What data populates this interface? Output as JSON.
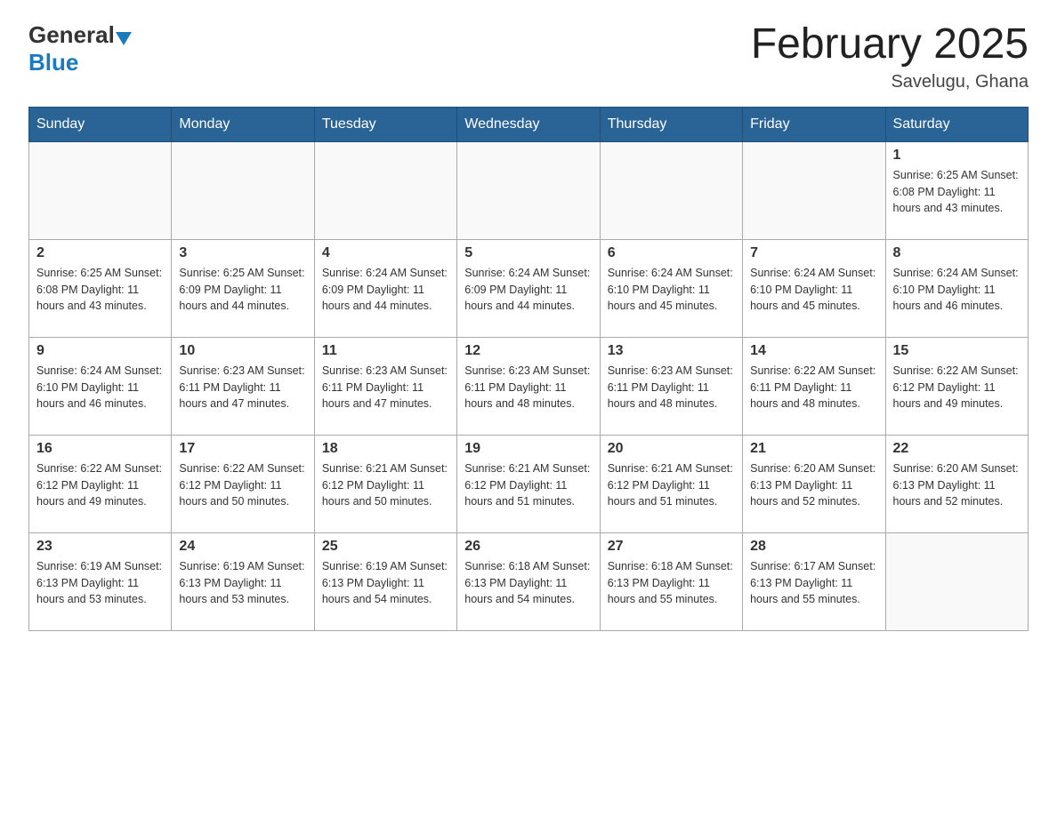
{
  "header": {
    "logo_general": "General",
    "logo_blue": "Blue",
    "title": "February 2025",
    "location": "Savelugu, Ghana"
  },
  "weekdays": [
    "Sunday",
    "Monday",
    "Tuesday",
    "Wednesday",
    "Thursday",
    "Friday",
    "Saturday"
  ],
  "weeks": [
    [
      {
        "day": "",
        "info": ""
      },
      {
        "day": "",
        "info": ""
      },
      {
        "day": "",
        "info": ""
      },
      {
        "day": "",
        "info": ""
      },
      {
        "day": "",
        "info": ""
      },
      {
        "day": "",
        "info": ""
      },
      {
        "day": "1",
        "info": "Sunrise: 6:25 AM\nSunset: 6:08 PM\nDaylight: 11 hours\nand 43 minutes."
      }
    ],
    [
      {
        "day": "2",
        "info": "Sunrise: 6:25 AM\nSunset: 6:08 PM\nDaylight: 11 hours\nand 43 minutes."
      },
      {
        "day": "3",
        "info": "Sunrise: 6:25 AM\nSunset: 6:09 PM\nDaylight: 11 hours\nand 44 minutes."
      },
      {
        "day": "4",
        "info": "Sunrise: 6:24 AM\nSunset: 6:09 PM\nDaylight: 11 hours\nand 44 minutes."
      },
      {
        "day": "5",
        "info": "Sunrise: 6:24 AM\nSunset: 6:09 PM\nDaylight: 11 hours\nand 44 minutes."
      },
      {
        "day": "6",
        "info": "Sunrise: 6:24 AM\nSunset: 6:10 PM\nDaylight: 11 hours\nand 45 minutes."
      },
      {
        "day": "7",
        "info": "Sunrise: 6:24 AM\nSunset: 6:10 PM\nDaylight: 11 hours\nand 45 minutes."
      },
      {
        "day": "8",
        "info": "Sunrise: 6:24 AM\nSunset: 6:10 PM\nDaylight: 11 hours\nand 46 minutes."
      }
    ],
    [
      {
        "day": "9",
        "info": "Sunrise: 6:24 AM\nSunset: 6:10 PM\nDaylight: 11 hours\nand 46 minutes."
      },
      {
        "day": "10",
        "info": "Sunrise: 6:23 AM\nSunset: 6:11 PM\nDaylight: 11 hours\nand 47 minutes."
      },
      {
        "day": "11",
        "info": "Sunrise: 6:23 AM\nSunset: 6:11 PM\nDaylight: 11 hours\nand 47 minutes."
      },
      {
        "day": "12",
        "info": "Sunrise: 6:23 AM\nSunset: 6:11 PM\nDaylight: 11 hours\nand 48 minutes."
      },
      {
        "day": "13",
        "info": "Sunrise: 6:23 AM\nSunset: 6:11 PM\nDaylight: 11 hours\nand 48 minutes."
      },
      {
        "day": "14",
        "info": "Sunrise: 6:22 AM\nSunset: 6:11 PM\nDaylight: 11 hours\nand 48 minutes."
      },
      {
        "day": "15",
        "info": "Sunrise: 6:22 AM\nSunset: 6:12 PM\nDaylight: 11 hours\nand 49 minutes."
      }
    ],
    [
      {
        "day": "16",
        "info": "Sunrise: 6:22 AM\nSunset: 6:12 PM\nDaylight: 11 hours\nand 49 minutes."
      },
      {
        "day": "17",
        "info": "Sunrise: 6:22 AM\nSunset: 6:12 PM\nDaylight: 11 hours\nand 50 minutes."
      },
      {
        "day": "18",
        "info": "Sunrise: 6:21 AM\nSunset: 6:12 PM\nDaylight: 11 hours\nand 50 minutes."
      },
      {
        "day": "19",
        "info": "Sunrise: 6:21 AM\nSunset: 6:12 PM\nDaylight: 11 hours\nand 51 minutes."
      },
      {
        "day": "20",
        "info": "Sunrise: 6:21 AM\nSunset: 6:12 PM\nDaylight: 11 hours\nand 51 minutes."
      },
      {
        "day": "21",
        "info": "Sunrise: 6:20 AM\nSunset: 6:13 PM\nDaylight: 11 hours\nand 52 minutes."
      },
      {
        "day": "22",
        "info": "Sunrise: 6:20 AM\nSunset: 6:13 PM\nDaylight: 11 hours\nand 52 minutes."
      }
    ],
    [
      {
        "day": "23",
        "info": "Sunrise: 6:19 AM\nSunset: 6:13 PM\nDaylight: 11 hours\nand 53 minutes."
      },
      {
        "day": "24",
        "info": "Sunrise: 6:19 AM\nSunset: 6:13 PM\nDaylight: 11 hours\nand 53 minutes."
      },
      {
        "day": "25",
        "info": "Sunrise: 6:19 AM\nSunset: 6:13 PM\nDaylight: 11 hours\nand 54 minutes."
      },
      {
        "day": "26",
        "info": "Sunrise: 6:18 AM\nSunset: 6:13 PM\nDaylight: 11 hours\nand 54 minutes."
      },
      {
        "day": "27",
        "info": "Sunrise: 6:18 AM\nSunset: 6:13 PM\nDaylight: 11 hours\nand 55 minutes."
      },
      {
        "day": "28",
        "info": "Sunrise: 6:17 AM\nSunset: 6:13 PM\nDaylight: 11 hours\nand 55 minutes."
      },
      {
        "day": "",
        "info": ""
      }
    ]
  ]
}
